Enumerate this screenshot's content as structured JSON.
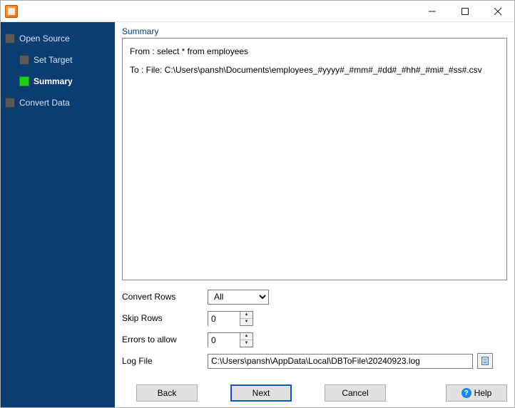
{
  "titlebar": {
    "title": ""
  },
  "sidebar": {
    "steps": [
      {
        "label": "Open Source",
        "active": false,
        "sub": false
      },
      {
        "label": "Set Target",
        "active": false,
        "sub": true
      },
      {
        "label": "Summary",
        "active": true,
        "sub": true
      },
      {
        "label": "Convert Data",
        "active": false,
        "sub": false
      }
    ]
  },
  "summary": {
    "heading": "Summary",
    "from_line": "From : select * from employees",
    "to_line": "To : File: C:\\Users\\pansh\\Documents\\employees_#yyyy#_#mm#_#dd#_#hh#_#mi#_#ss#.csv"
  },
  "form": {
    "convert_rows_label": "Convert Rows",
    "convert_rows_value": "All",
    "skip_rows_label": "Skip Rows",
    "skip_rows_value": "0",
    "errors_label": "Errors to allow",
    "errors_value": "0",
    "logfile_label": "Log File",
    "logfile_value": "C:\\Users\\pansh\\AppData\\Local\\DBToFile\\20240923.log"
  },
  "buttons": {
    "back": "Back",
    "next": "Next",
    "cancel": "Cancel",
    "help": "Help"
  }
}
